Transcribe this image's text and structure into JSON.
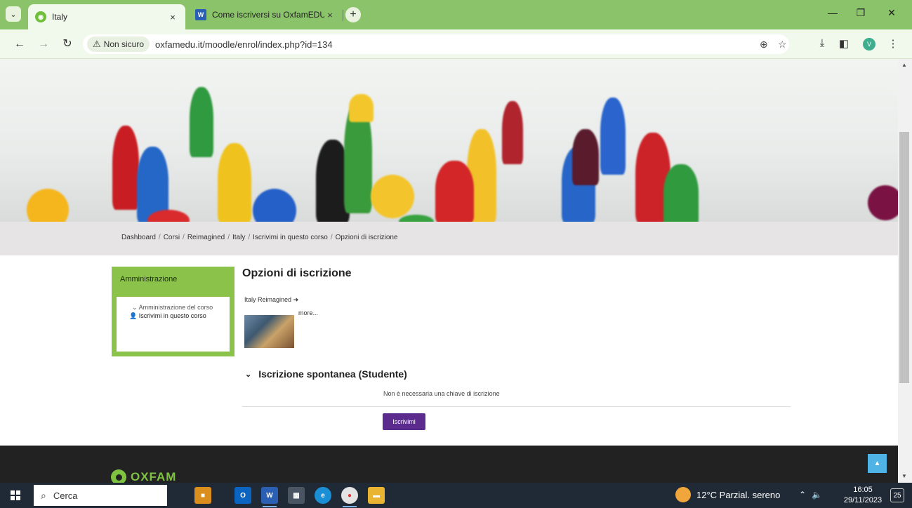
{
  "browser": {
    "tabs": [
      {
        "title": "Italy",
        "active": true
      },
      {
        "title": "Come iscriversi su OxfamEDU.it",
        "active": false
      }
    ],
    "close_glyph": "×",
    "new_tab_glyph": "+",
    "security_label": "Non sicuro",
    "url": "oxfamedu.it/moodle/enrol/index.php?id=134",
    "profile_initial": "V"
  },
  "page": {
    "breadcrumb": [
      "Dashboard",
      "Corsi",
      "Reimagined",
      "Italy",
      "Iscrivimi in questo corso",
      "Opzioni di iscrizione"
    ],
    "breadcrumb_sep": "/",
    "admin": {
      "title": "Amministrazione",
      "node_label": "Amministrazione del corso",
      "leaf_label": "Iscrivimi in questo corso"
    },
    "title": "Opzioni di iscrizione",
    "course_name": "Italy Reimagined",
    "more_label": "more...",
    "section_title": "Iscrizione spontanea (Studente)",
    "no_key_text": "Non è necessaria una chiave di iscrizione",
    "enrol_button": "Iscrivimi",
    "footer_logo": "OXFAM"
  },
  "taskbar": {
    "search_placeholder": "Cerca",
    "weather": "12°C  Parzial. sereno",
    "time": "16:05",
    "date": "29/11/2023",
    "notification_count": "25"
  },
  "colors": {
    "tab_bar": "#8bc36a",
    "admin_block": "#8bc34a",
    "enrol_button": "#5b2c8e",
    "footer": "#222222",
    "back_to_top": "#4fb3e6"
  }
}
